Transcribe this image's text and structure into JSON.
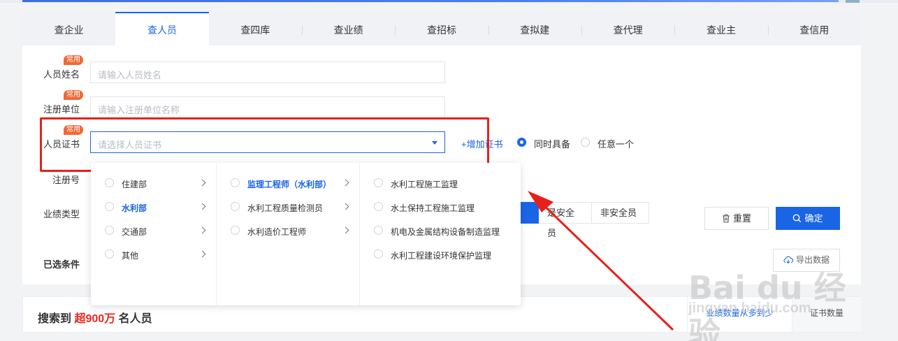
{
  "tabs": [
    {
      "label": "查企业"
    },
    {
      "label": "查人员"
    },
    {
      "label": "查四库"
    },
    {
      "label": "查业绩"
    },
    {
      "label": "查招标"
    },
    {
      "label": "查拟建"
    },
    {
      "label": "查代理"
    },
    {
      "label": "查业主"
    },
    {
      "label": "查信用"
    }
  ],
  "active_tab": "查人员",
  "tag_common": "常用",
  "form": {
    "name_label": "人员姓名",
    "name_placeholder": "请输入人员姓名",
    "unit_label": "注册单位",
    "unit_placeholder": "请输入注册单位名称",
    "cert_label": "人员证书",
    "cert_placeholder": "请选择人员证书",
    "add_cert": "+增加证书",
    "radio_all": "同时具备",
    "radio_any": "任意一个",
    "regno_label": "注册号",
    "perf_label": "业绩类型",
    "selected_label": "已选条件"
  },
  "perf_segments": {
    "seg_safety": "是安全员",
    "seg_non_safety": "非安全员"
  },
  "buttons": {
    "reset": "重置",
    "confirm": "确定",
    "export": "导出数据"
  },
  "result": {
    "prefix": "搜索到",
    "count": "超900万",
    "suffix": "名人员",
    "sort_perf": "业绩数量从多到少",
    "sort_cert": "证书数量"
  },
  "cascader": {
    "col1": [
      {
        "label": "住建部"
      },
      {
        "label": "水利部"
      },
      {
        "label": "交通部"
      },
      {
        "label": "其他"
      }
    ],
    "col2": [
      {
        "label": "监理工程师（水利部）"
      },
      {
        "label": "水利工程质量检测员"
      },
      {
        "label": "水利造价工程师"
      }
    ],
    "col3": [
      {
        "label": "水利工程施工监理"
      },
      {
        "label": "水土保持工程施工监理"
      },
      {
        "label": "机电及金属结构设备制造监理"
      },
      {
        "label": "水利工程建设环境保护监理"
      }
    ]
  },
  "watermark": {
    "line1": "Bai du 经验",
    "line2": "jingyan.baidu.com"
  },
  "colors": {
    "accent": "#1a65e6",
    "highlight": "#e8201a",
    "tag": "#f06a35"
  }
}
